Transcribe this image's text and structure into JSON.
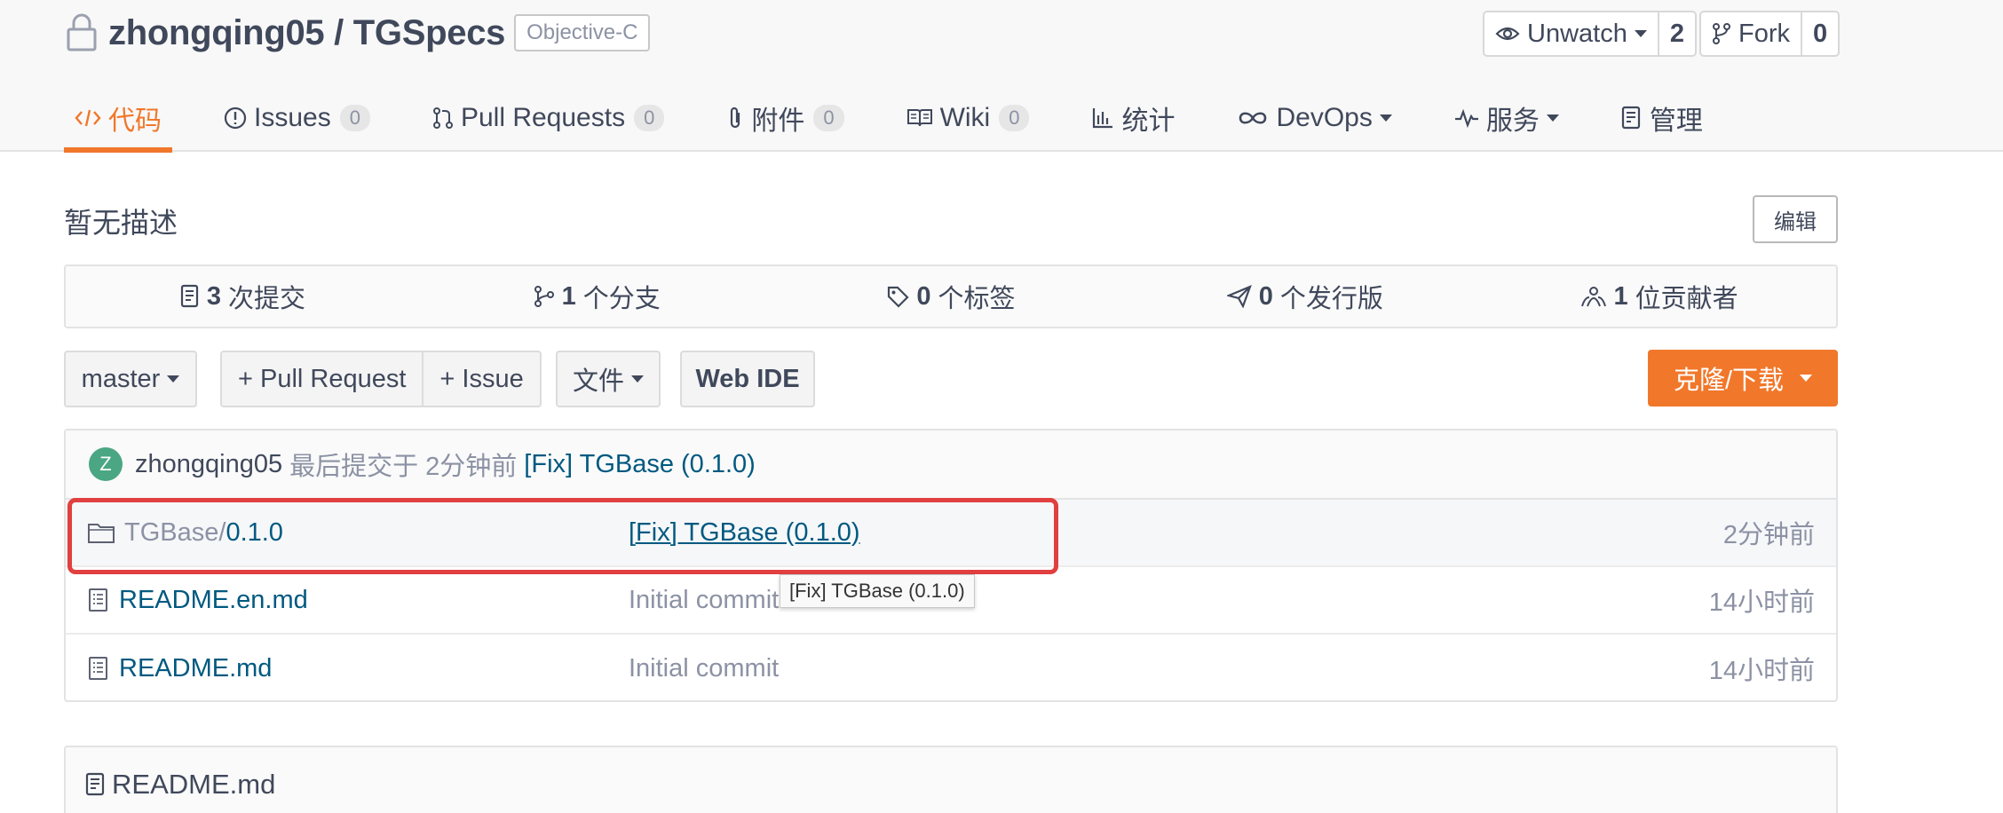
{
  "repo": {
    "owner": "zhongqing05",
    "separator": " / ",
    "name": "TGSpecs",
    "language": "Objective-C"
  },
  "social": {
    "watch_label": "Unwatch",
    "watch_count": "2",
    "fork_label": "Fork",
    "fork_count": "0"
  },
  "nav": {
    "code": "代码",
    "issues": "Issues",
    "issues_count": "0",
    "pulls": "Pull Requests",
    "pulls_count": "0",
    "attachments": "附件",
    "attachments_count": "0",
    "wiki": "Wiki",
    "wiki_count": "0",
    "stats": "统计",
    "devops": "DevOps",
    "services": "服务",
    "manage": "管理"
  },
  "description": "暂无描述",
  "edit_label": "编辑",
  "stats": {
    "commits_count": "3",
    "commits_label": "次提交",
    "branches_count": "1",
    "branches_label": "个分支",
    "tags_count": "0",
    "tags_label": "个标签",
    "releases_count": "0",
    "releases_label": "个发行版",
    "contributors_count": "1",
    "contributors_label": "位贡献者"
  },
  "toolbar": {
    "branch": "master",
    "pull_request": "+ Pull Request",
    "issue": "+ Issue",
    "files": "文件",
    "web_ide": "Web IDE",
    "clone": "克隆/下载"
  },
  "last_commit": {
    "avatar_letter": "Z",
    "user": "zhongqing05",
    "meta": "最后提交于 2分钟前",
    "message": "[Fix] TGBase (0.1.0)"
  },
  "files": [
    {
      "prefix": "TGBase/",
      "name": " 0.1.0",
      "commit": "[Fix] TGBase (0.1.0)",
      "time": "2分钟前"
    },
    {
      "prefix": "",
      "name": "README.en.md",
      "commit": "Initial commit",
      "time": "14小时前"
    },
    {
      "prefix": "",
      "name": "README.md",
      "commit": "Initial commit",
      "time": "14小时前"
    }
  ],
  "tooltip": "[Fix] TGBase (0.1.0)",
  "readme_title": "README.md",
  "colors": {
    "accent": "#f1772a",
    "link": "#005980",
    "highlight": "#e0403f",
    "avatar": "#4aa683"
  }
}
